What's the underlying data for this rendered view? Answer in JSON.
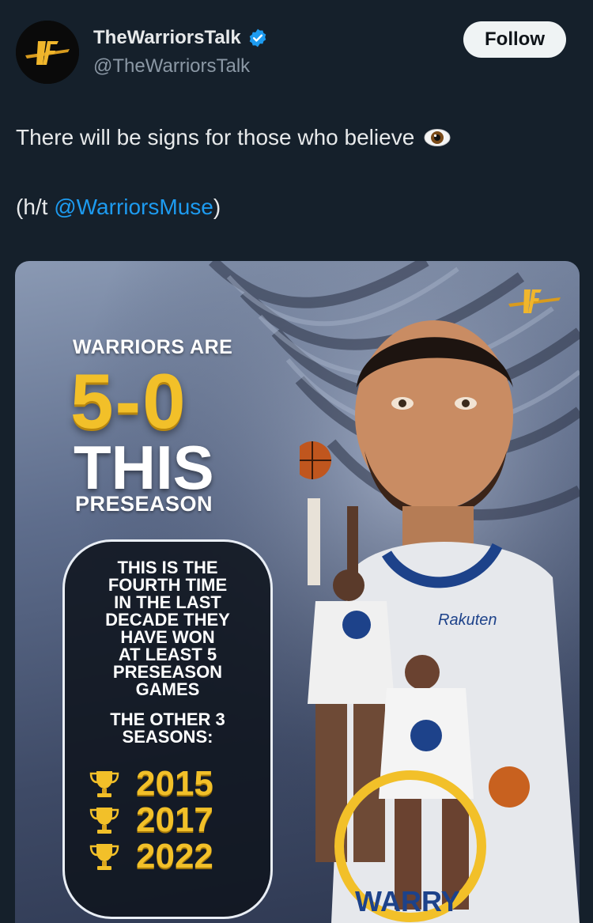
{
  "account": {
    "display_name": "TheWarriorsTalk",
    "handle": "@TheWarriorsTalk",
    "verified": true,
    "follow_label": "Follow"
  },
  "tweet": {
    "line1": "There will be signs for those who believe",
    "line1_emoji": "eye-icon",
    "line2_prefix": "(h/t ",
    "mention": "@WarriorsMuse",
    "line2_suffix": ")"
  },
  "graphic": {
    "headline_top": "WARRIORS ARE",
    "headline_score": "5-0",
    "headline_this": "THIS",
    "headline_bottom": "PRESEASON",
    "box_lines": [
      "THIS IS THE",
      "FOURTH TIME",
      "IN THE LAST",
      "DECADE THEY",
      "HAVE WON",
      "AT LEAST 5",
      "PRESEASON",
      "GAMES"
    ],
    "box_sub_lines": [
      "THE OTHER 3",
      "SEASONS:"
    ],
    "years": [
      "2015",
      "2017",
      "2022"
    ],
    "jersey_sponsor": "Rakuten",
    "court_text": "WARRY"
  },
  "colors": {
    "background": "#15202b",
    "accent_link": "#1d9bf0",
    "gold": "#f2c029",
    "verified_blue": "#1d9bf0"
  }
}
